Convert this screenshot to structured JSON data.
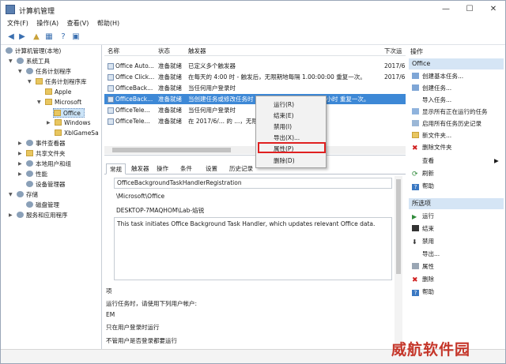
{
  "window": {
    "title": "计算机管理"
  },
  "menu": [
    "文件(F)",
    "操作(A)",
    "查看(V)",
    "帮助(H)"
  ],
  "tree": {
    "root": "计算机管理(本地)",
    "system_tools": "系统工具",
    "task_scheduler": "任务计划程序",
    "task_library": "任务计划程序库",
    "apple": "Apple",
    "microsoft": "Microsoft",
    "office": "Office",
    "windows": "Windows",
    "xbl": "XblGameSa",
    "event_viewer": "事件查看器",
    "shared_folders": "共享文件夹",
    "local_users": "本地用户和组",
    "performance": "性能",
    "device_manager": "设备管理器",
    "storage": "存储",
    "disk_management": "磁盘管理",
    "services": "服务和应用程序"
  },
  "task_list": {
    "columns": [
      "名称",
      "状态",
      "触发器",
      "下次运"
    ],
    "rows": [
      {
        "name": "Office Auto...",
        "status": "准备就绪",
        "trigger": "已定义多个触发器",
        "next": "2017/6"
      },
      {
        "name": "Office Click...",
        "status": "准备就绪",
        "trigger": "在每天的 4:00 时 - 触发后，无限期地每隔 1.00:00:00 重复一次。",
        "next": "2017/6"
      },
      {
        "name": "OfficeBack...",
        "status": "准备就绪",
        "trigger": "当任何用户登录时",
        "next": ""
      },
      {
        "name": "OfficeBack...",
        "status": "准备就绪",
        "trigger": "当创建任务或修改任务时 - 触发后，无限期地每隔 1 小时 重复一次。",
        "next": ""
      },
      {
        "name": "OfficeTele...",
        "status": "准备就绪",
        "trigger": "当任何用户登录时",
        "next": ""
      },
      {
        "name": "OfficeTele...",
        "status": "准备就绪",
        "trigger": "在 2017/6/... 的 ...，无限期地每隔 ... 重复一次。",
        "next": ""
      }
    ]
  },
  "context_menu": {
    "run": "运行(R)",
    "end": "结束(E)",
    "disable": "禁用(I)",
    "export": "导出(X)...",
    "properties": "属性(P)",
    "delete": "删除(D)"
  },
  "detail": {
    "tabs": [
      "常规",
      "触发器",
      "操作",
      "条件",
      "设置",
      "历史记录"
    ],
    "name_value": "OfficeBackgroundTaskHandlerRegistration",
    "location_value": "\\Microsoft\\Office",
    "author_value": "DESKTOP-7MAQHOM\\Lab-焰锐",
    "description_value": "This task initiates Office Background Task Handler, which updates relevant Office data.",
    "security_label": "项",
    "run_as_label": "运行任务时，请使用下列用户帐户:",
    "account_value": "EM",
    "run_when_label": "只在用户登录时运行",
    "bottom_label": "不管用户是否登录都要运行"
  },
  "actions": {
    "header": "操作",
    "section1": "Office",
    "section1_items": [
      {
        "icon": "create-basic-task-icon",
        "label": "创建基本任务..."
      },
      {
        "icon": "create-task-icon",
        "label": "创建任务..."
      },
      {
        "icon": "",
        "label": "导入任务..."
      },
      {
        "icon": "show-running-icon",
        "label": "显示所有正在运行的任务"
      },
      {
        "icon": "history-icon",
        "label": "启用所有任务历史记录"
      },
      {
        "icon": "new-folder-icon",
        "label": "新文件夹..."
      },
      {
        "icon": "delete-folder-icon",
        "label": "删除文件夹"
      },
      {
        "icon": "",
        "label": "查看"
      },
      {
        "icon": "refresh-icon",
        "label": "刷新"
      },
      {
        "icon": "help-icon",
        "label": "帮助"
      }
    ],
    "section2": "所选项",
    "section2_items": [
      {
        "icon": "run-icon",
        "label": "运行"
      },
      {
        "icon": "end-icon",
        "label": "结束"
      },
      {
        "icon": "disable-icon",
        "label": "禁用"
      },
      {
        "icon": "",
        "label": "导出..."
      },
      {
        "icon": "properties-icon",
        "label": "属性"
      },
      {
        "icon": "delete-icon",
        "label": "删除"
      },
      {
        "icon": "help-icon",
        "label": "帮助"
      }
    ]
  },
  "watermark": "威航软件园",
  "colors": {
    "selection": "#3d88d6",
    "highlight_box": "#e02020",
    "watermark": "#c5362a"
  }
}
